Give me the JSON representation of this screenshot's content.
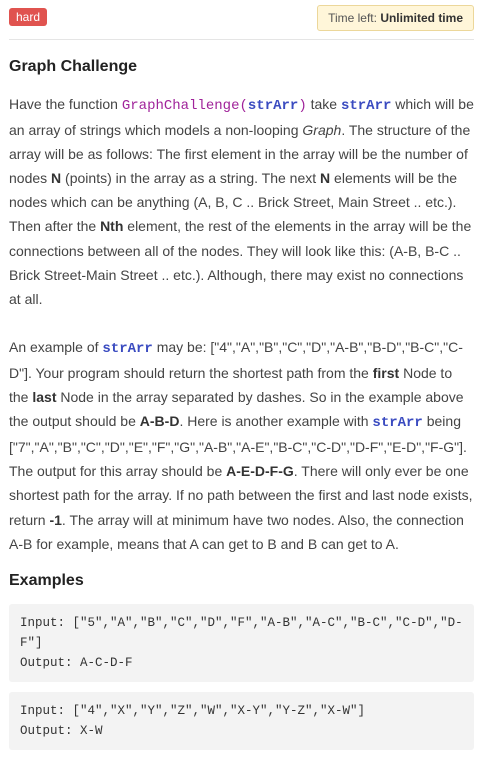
{
  "header": {
    "difficulty": "hard",
    "time_label": "Time left: ",
    "time_value": "Unlimited time"
  },
  "challenge": {
    "title": "Graph Challenge",
    "p1": {
      "t1": "Have the function ",
      "fn": "GraphChallenge(",
      "arg": "strArr",
      "fn_close": ")",
      "t2": " take ",
      "arg2": "strArr",
      "t3": " which will be an array of strings which models a non-looping ",
      "graph": "Graph",
      "t4": ". The structure of the array will be as follows: The first element in the array will be the number of nodes ",
      "n": "N",
      "t5": " (points) in the array as a string. The next ",
      "n2": "N",
      "t6": " elements will be the nodes which can be anything (A, B, C .. Brick Street, Main Street .. etc.). Then after the ",
      "nth": "Nth",
      "t7": " element, the rest of the elements in the array will be the connections between all of the nodes. They will look like this: (A-B, B-C .. Brick Street-Main Street .. etc.). Although, there may exist no connections at all."
    },
    "p2": {
      "t1": "An example of ",
      "arg": "strArr",
      "t2": " may be: [\"4\",\"A\",\"B\",\"C\",\"D\",\"A-B\",\"B-D\",\"B-C\",\"C-D\"]. Your program should return the shortest path from the ",
      "first": "first",
      "t3": " Node to the ",
      "last": "last",
      "t4": " Node in the array separated by dashes. So in the example above the output should be ",
      "abd": "A-B-D",
      "t5": ". Here is another example with ",
      "arg2": "strArr",
      "t6": " being [\"7\",\"A\",\"B\",\"C\",\"D\",\"E\",\"F\",\"G\",\"A-B\",\"A-E\",\"B-C\",\"C-D\",\"D-F\",\"E-D\",\"F-G\"]. The output for this array should be ",
      "aedfg": "A-E-D-F-G",
      "t7": ". There will only ever be one shortest path for the array. If no path between the first and last node exists, return ",
      "neg": "-1",
      "t8": ". The array will at minimum have two nodes. Also, the connection A-B for example, means that A can get to B and B can get to A."
    }
  },
  "examples": {
    "title": "Examples",
    "items": [
      {
        "input": "Input: [\"5\",\"A\",\"B\",\"C\",\"D\",\"F\",\"A-B\",\"A-C\",\"B-C\",\"C-D\",\"D-F\"]",
        "output": "Output: A-C-D-F"
      },
      {
        "input": "Input: [\"4\",\"X\",\"Y\",\"Z\",\"W\",\"X-Y\",\"Y-Z\",\"X-W\"]",
        "output": "Output: X-W"
      }
    ]
  }
}
